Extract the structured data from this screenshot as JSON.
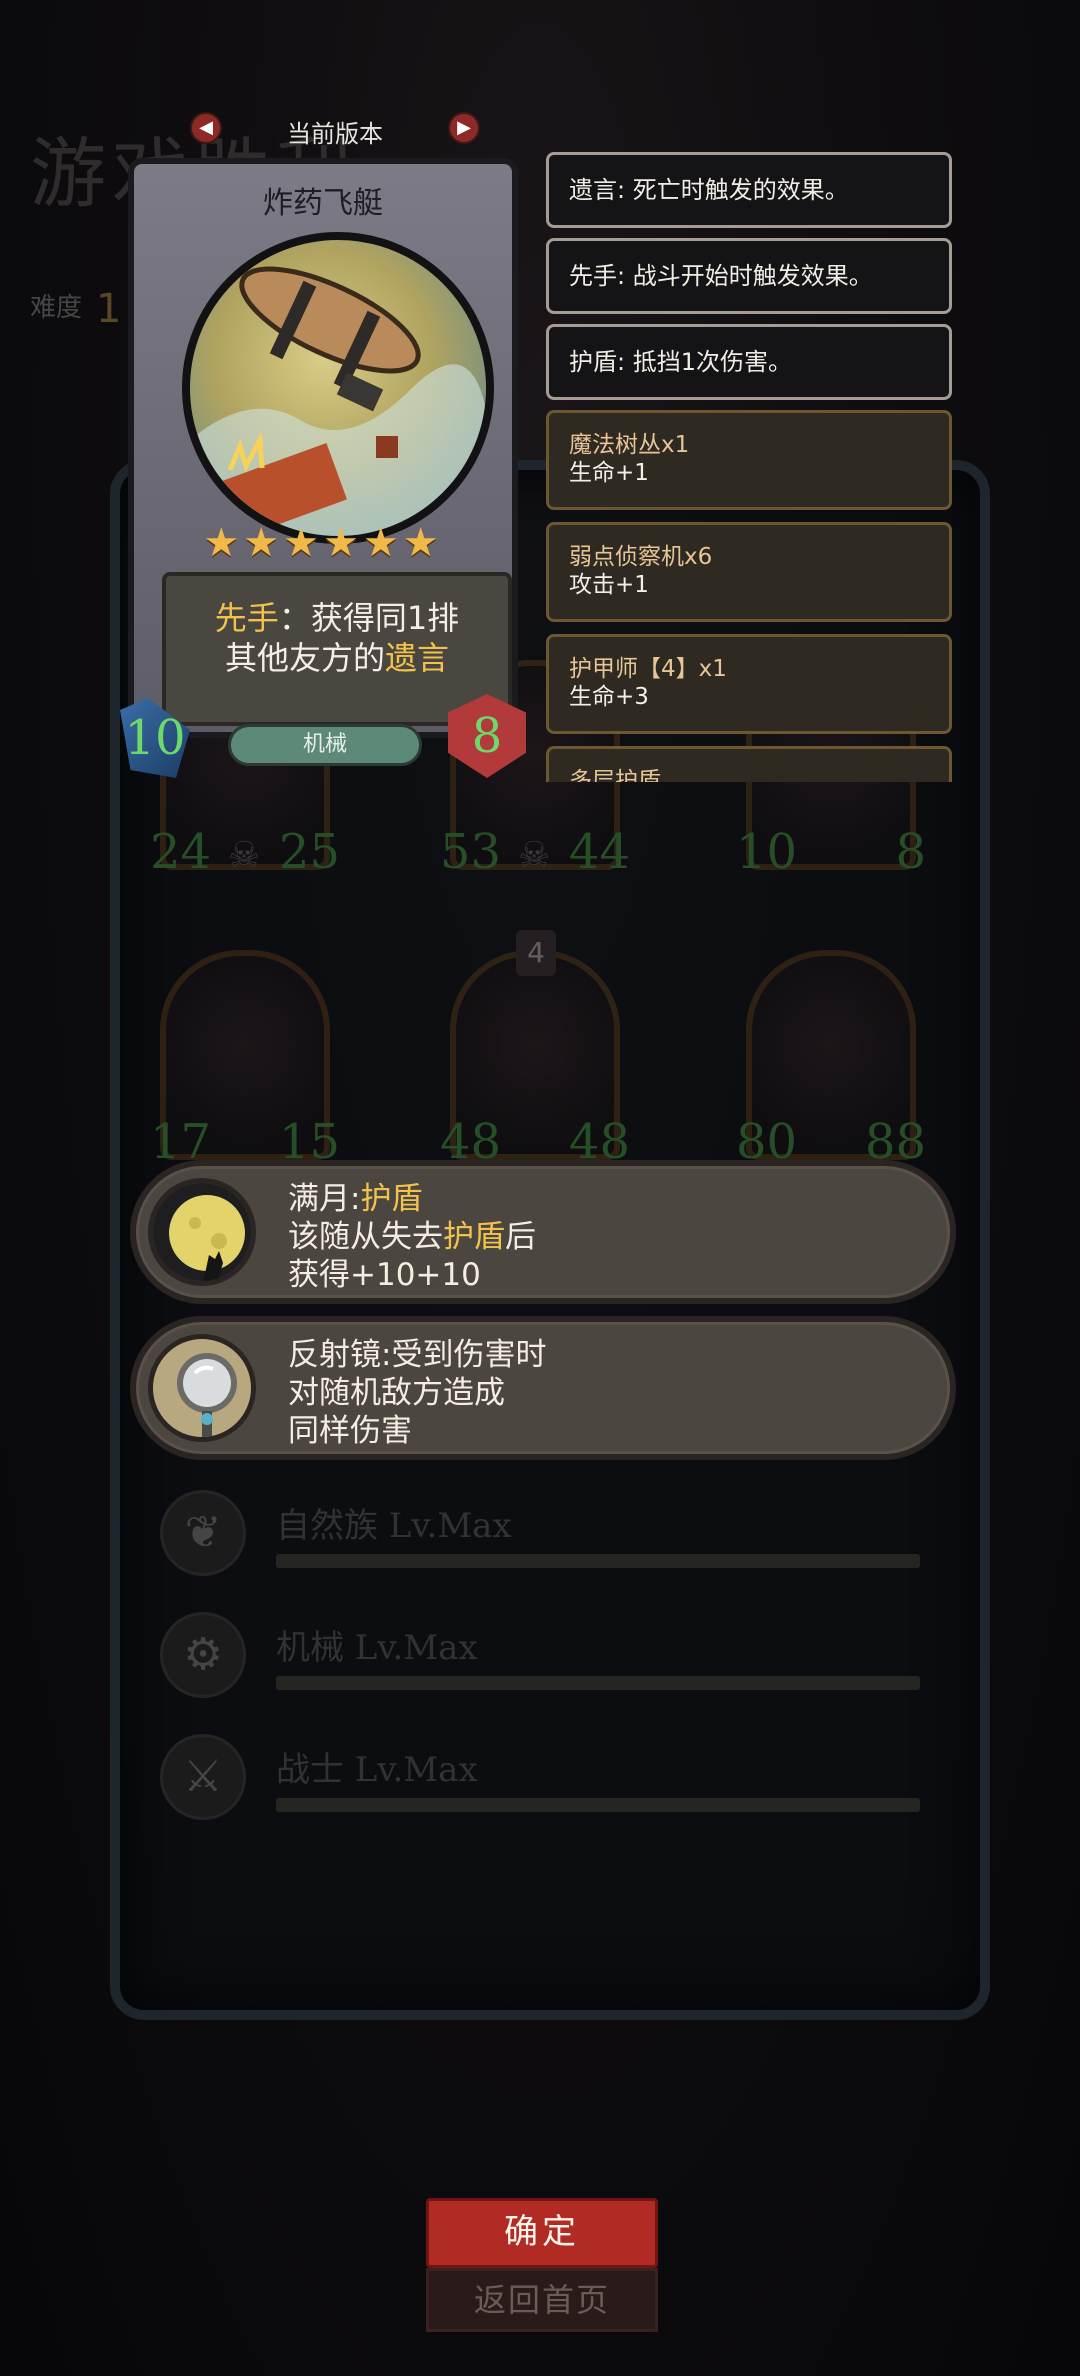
{
  "background": {
    "title": "游戏胜利",
    "difficulty_label": "难度",
    "difficulty_value": "1"
  },
  "board": {
    "row1": [
      {
        "attack": "24",
        "health": "25"
      },
      {
        "attack": "53",
        "health": "44"
      },
      {
        "attack": "10",
        "health": "8"
      }
    ],
    "row2": [
      {
        "attack": "17",
        "health": "15"
      },
      {
        "attack": "48",
        "health": "48",
        "tier": "4"
      },
      {
        "attack": "80",
        "health": "88"
      }
    ]
  },
  "tribes": [
    {
      "label": "自然族 Lv.Max",
      "icon": "nature-icon"
    },
    {
      "label": "机械 Lv.Max",
      "icon": "mech-icon"
    },
    {
      "label": "战士 Lv.Max",
      "icon": "sword-icon"
    }
  ],
  "relics": [
    {
      "icon": "full-moon-icon",
      "line1_prefix": "满月:",
      "line1_highlight": "护盾",
      "line2_prefix": "该随从失去",
      "line2_highlight": "护盾",
      "line2_suffix": "后",
      "line3": "获得+10+10"
    },
    {
      "icon": "mirror-icon",
      "line1": "反射镜:受到伤害时",
      "line2": "对随机敌方造成",
      "line3": "同样伤害"
    }
  ],
  "card": {
    "version_label": "当前版本",
    "name": "炸药飞艇",
    "stars": "★★★★★★",
    "desc_kw1": "先手",
    "desc_line1": "：获得同1排",
    "desc_line2": "其他友方的",
    "desc_kw2": "遗言",
    "attack": "10",
    "tribe": "机械",
    "health": "8"
  },
  "keywords": [
    "遗言: 死亡时触发的效果。",
    "先手: 战斗开始时触发效果。",
    "护盾: 抵挡1次伤害。"
  ],
  "buffs": [
    {
      "name": "魔法树丛x1",
      "stat": "生命+1"
    },
    {
      "name": "弱点侦察机x6",
      "stat": "攻击+1"
    },
    {
      "name": "护甲师【4】x1",
      "stat": "生命+3"
    },
    {
      "name": "多层护盾",
      "stat": ""
    }
  ],
  "buttons": {
    "confirm": "确定",
    "home": "返回首页"
  },
  "colors": {
    "accent_gold": "#f1c34c",
    "stat_green": "#6fd86a",
    "button_red": "#b22a24"
  }
}
